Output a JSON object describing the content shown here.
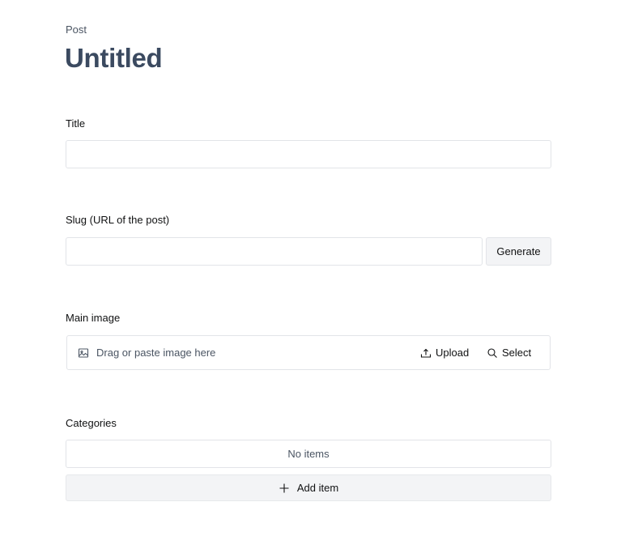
{
  "document": {
    "type_label": "Post",
    "title": "Untitled"
  },
  "fields": {
    "title": {
      "label": "Title",
      "value": "",
      "placeholder": ""
    },
    "slug": {
      "label": "Slug (URL of the post)",
      "value": "",
      "placeholder": "",
      "generate_label": "Generate"
    },
    "main_image": {
      "label": "Main image",
      "drop_hint": "Drag or paste image here",
      "upload_label": "Upload",
      "select_label": "Select",
      "icons": {
        "hint": "image-icon",
        "upload": "upload-icon",
        "select": "search-icon"
      }
    },
    "categories": {
      "label": "Categories",
      "empty_text": "No items",
      "add_label": "Add item",
      "add_icon": "plus-icon"
    }
  },
  "colors": {
    "title": "#3b4a60",
    "border": "#e2e4e8",
    "button_bg": "#f3f4f6",
    "muted_text": "#4b5563"
  }
}
